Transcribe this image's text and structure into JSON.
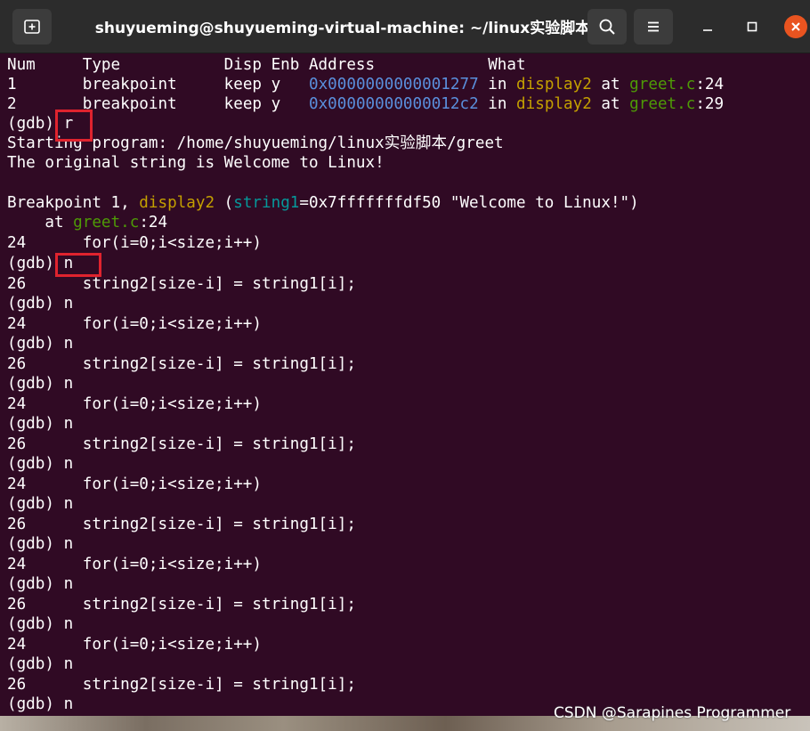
{
  "window": {
    "title": "shuyueming@shuyueming-virtual-machine: ~/linux实验脚本"
  },
  "terminal": {
    "header": "Num     Type           Disp Enb Address            What",
    "breakpoints": [
      {
        "num": "1",
        "type": "breakpoint",
        "disp": "keep",
        "enb": "y",
        "address": "0x0000000000001277",
        "in": "in",
        "func": "display2",
        "at": "at",
        "file": "greet.c",
        "line": ":24"
      },
      {
        "num": "2",
        "type": "breakpoint",
        "disp": "keep",
        "enb": "y",
        "address": "0x00000000000012c2",
        "in": "in",
        "func": "display2",
        "at": "at",
        "file": "greet.c",
        "line": ":29"
      }
    ],
    "prompt": "(gdb) ",
    "run_cmd": "r",
    "starting": "Starting program: /home/shuyueming/linux实验脚本/greet",
    "output": "The original string is Welcome to Linux!",
    "bp_prefix": "Breakpoint 1, ",
    "bp_func": "display2",
    "bp_open": " (",
    "bp_argname": "string1",
    "bp_argval": "=0x7fffffffdf50 \"Welcome to Linux!\")",
    "at_prefix": "    at ",
    "at_file": "greet.c",
    "at_line": ":24",
    "src24": "24      for(i=0;i<size;i++)",
    "next_cmd": "n",
    "src26": "26      string2[size-i] = string1[i];"
  },
  "watermark": "CSDN @Sarapines Programmer",
  "colors": {
    "terminal_bg": "#300a24",
    "address": "#5a8fdc",
    "function": "#c4a000",
    "file": "#4e9a06",
    "argument": "#06989a",
    "highlight_box": "#e0232e",
    "close_button": "#e95420"
  }
}
